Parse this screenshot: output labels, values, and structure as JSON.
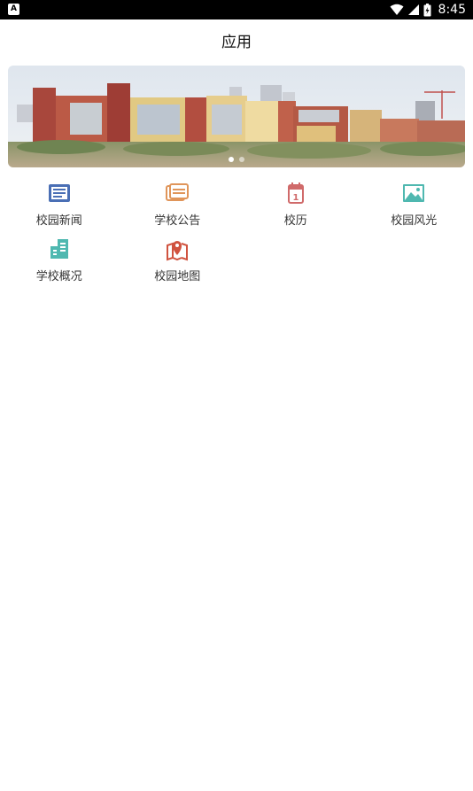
{
  "status": {
    "time": "8:45"
  },
  "header": {
    "title": "应用"
  },
  "banner": {
    "slides": 2,
    "active": 1
  },
  "apps": [
    [
      {
        "id": "news",
        "label": "校园新闻",
        "icon": "news-icon",
        "color": "#4a6fb5"
      },
      {
        "id": "notice",
        "label": "学校公告",
        "icon": "notice-icon",
        "color": "#e0955a"
      },
      {
        "id": "calendar",
        "label": "校历",
        "icon": "calendar-icon",
        "color": "#d06a6a"
      },
      {
        "id": "scenery",
        "label": "校园风光",
        "icon": "scenery-icon",
        "color": "#4fb8b0"
      }
    ],
    [
      {
        "id": "overview",
        "label": "学校概况",
        "icon": "building-icon",
        "color": "#4fb8b0"
      },
      {
        "id": "map",
        "label": "校园地图",
        "icon": "map-icon",
        "color": "#d0533f"
      }
    ]
  ]
}
